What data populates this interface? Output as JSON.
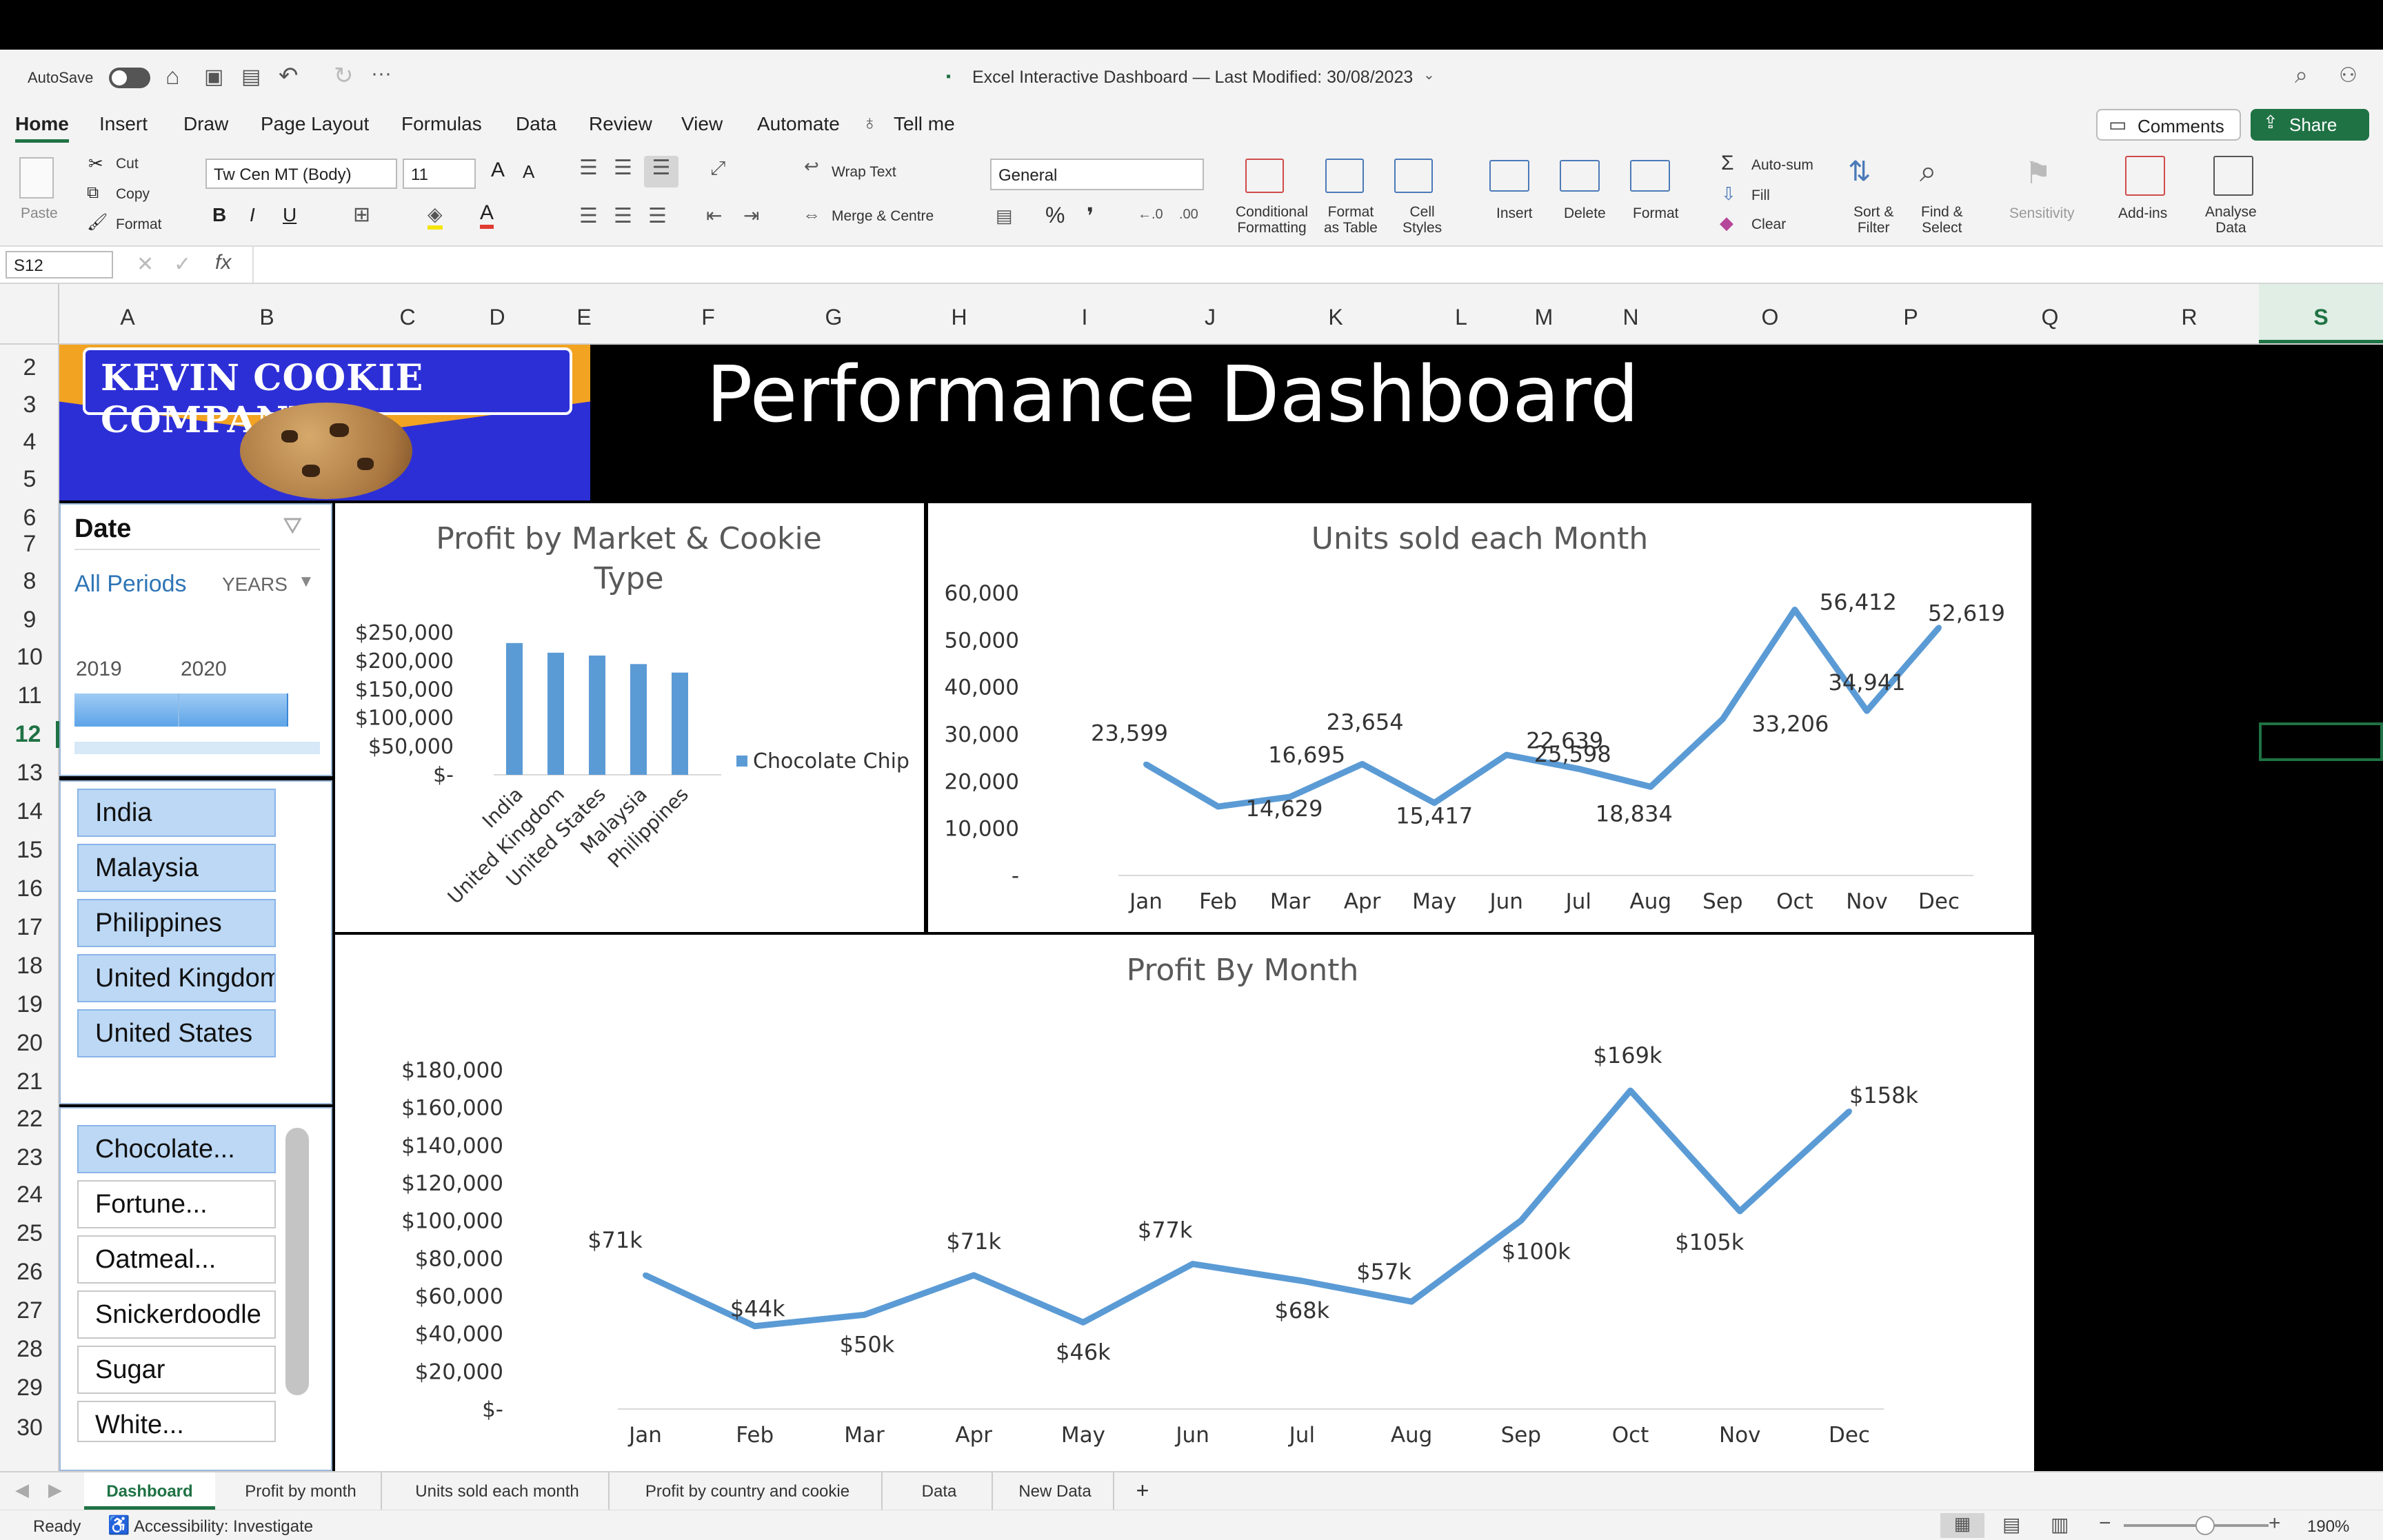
{
  "titlebar": {
    "autosave_label": "AutoSave",
    "doc_title": "Excel Interactive Dashboard — Last Modified: 30/08/2023",
    "comments_label": "Comments",
    "share_label": "Share"
  },
  "ribbon_tabs": [
    "Home",
    "Insert",
    "Draw",
    "Page Layout",
    "Formulas",
    "Data",
    "Review",
    "View",
    "Automate",
    "Tell me"
  ],
  "ribbon": {
    "paste": "Paste",
    "cut": "Cut",
    "copy": "Copy",
    "format_painter": "Format",
    "font_name": "Tw Cen MT (Body)",
    "font_size": "11",
    "bold": "B",
    "italic": "I",
    "underline": "U",
    "wrap_text": "Wrap Text",
    "merge_centre": "Merge & Centre",
    "number_format": "General",
    "percent": "%",
    "comma": "❜",
    "cond_format": [
      "Conditional",
      "Formatting"
    ],
    "format_table": [
      "Format",
      "as Table"
    ],
    "cell_styles": [
      "Cell",
      "Styles"
    ],
    "insert": "Insert",
    "delete": "Delete",
    "format": "Format",
    "autosum": "Auto-sum",
    "fill": "Fill",
    "clear": "Clear",
    "sort_filter": [
      "Sort &",
      "Filter"
    ],
    "find_select": [
      "Find &",
      "Select"
    ],
    "sensitivity": "Sensitivity",
    "addins": "Add-ins",
    "analyse": [
      "Analyse",
      "Data"
    ]
  },
  "formula_bar": {
    "name_box": "S12",
    "formula": ""
  },
  "columns": [
    "A",
    "B",
    "C",
    "D",
    "E",
    "F",
    "G",
    "H",
    "I",
    "J",
    "K",
    "L",
    "M",
    "N",
    "O",
    "P",
    "Q",
    "R",
    "S"
  ],
  "rows": [
    "2",
    "3",
    "4",
    "5",
    "6",
    "7",
    "8",
    "9",
    "10",
    "11",
    "12",
    "13",
    "14",
    "15",
    "16",
    "17",
    "18",
    "19",
    "20",
    "21",
    "22",
    "23",
    "24",
    "25",
    "26",
    "27",
    "28",
    "29",
    "30"
  ],
  "dashboard": {
    "logo_text": "KEVIN COOKIE COMPANY",
    "title": "Performance Dashboard"
  },
  "date_slicer": {
    "title": "Date",
    "all_periods": "All Periods",
    "level": "YEARS",
    "years": [
      "2019",
      "2020"
    ]
  },
  "country_slicer": [
    "India",
    "Malaysia",
    "Philippines",
    "United Kingdom",
    "United States"
  ],
  "cookie_slicer": [
    "Chocolate...",
    "Fortune...",
    "Oatmeal...",
    "Snickerdoodle",
    "Sugar",
    "White..."
  ],
  "sheet_tabs": [
    "Dashboard",
    "Profit by month",
    "Units sold each month",
    "Profit by country and cookie",
    "Data",
    "New Data",
    "+"
  ],
  "status": {
    "ready": "Ready",
    "accessibility": "Accessibility: Investigate",
    "zoom": "190%"
  },
  "colors": {
    "accent": "#1f7244",
    "series": "#5b9bd5",
    "slicer_on": "#bcd8f5"
  },
  "chart_data": [
    {
      "type": "bar",
      "title": "Profit by Market & Cookie Type",
      "categories": [
        "India",
        "United Kingdom",
        "United States",
        "Malaysia",
        "Philippines"
      ],
      "series": [
        {
          "name": "Chocolate Chip",
          "values": [
            232000,
            215000,
            210000,
            195000,
            180000
          ]
        }
      ],
      "ylim": [
        0,
        250000
      ],
      "yticks": [
        "$-",
        "$50,000",
        "$100,000",
        "$150,000",
        "$200,000",
        "$250,000"
      ],
      "legend": "right"
    },
    {
      "type": "line",
      "title": "Units sold each Month",
      "categories": [
        "Jan",
        "Feb",
        "Mar",
        "Apr",
        "May",
        "Jun",
        "Jul",
        "Aug",
        "Sep",
        "Oct",
        "Nov",
        "Dec"
      ],
      "values": [
        23599,
        14629,
        16695,
        23654,
        15417,
        25598,
        22639,
        18834,
        33206,
        56412,
        34941,
        52619
      ],
      "labels": [
        "23,599",
        "14,629",
        "16,695",
        "23,654",
        "15,417",
        "25,598",
        "22,639",
        "18,834",
        "33,206",
        "56,412",
        "34,941",
        "52,619"
      ],
      "ylim": [
        0,
        60000
      ],
      "yticks": [
        "-",
        "10,000",
        "20,000",
        "30,000",
        "40,000",
        "50,000",
        "60,000"
      ]
    },
    {
      "type": "line",
      "title": "Profit By Month",
      "categories": [
        "Jan",
        "Feb",
        "Mar",
        "Apr",
        "May",
        "Jun",
        "Jul",
        "Aug",
        "Sep",
        "Oct",
        "Nov",
        "Dec"
      ],
      "values": [
        71000,
        44000,
        50000,
        71000,
        46000,
        77000,
        68000,
        57000,
        100000,
        169000,
        105000,
        158000
      ],
      "labels": [
        "$71k",
        "$44k",
        "$50k",
        "$71k",
        "$46k",
        "$77k",
        "$68k",
        "$57k",
        "$100k",
        "$169k",
        "$105k",
        "$158k"
      ],
      "ylim": [
        0,
        180000
      ],
      "yticks": [
        "$-",
        "$20,000",
        "$40,000",
        "$60,000",
        "$80,000",
        "$100,000",
        "$120,000",
        "$140,000",
        "$160,000",
        "$180,000"
      ]
    }
  ]
}
